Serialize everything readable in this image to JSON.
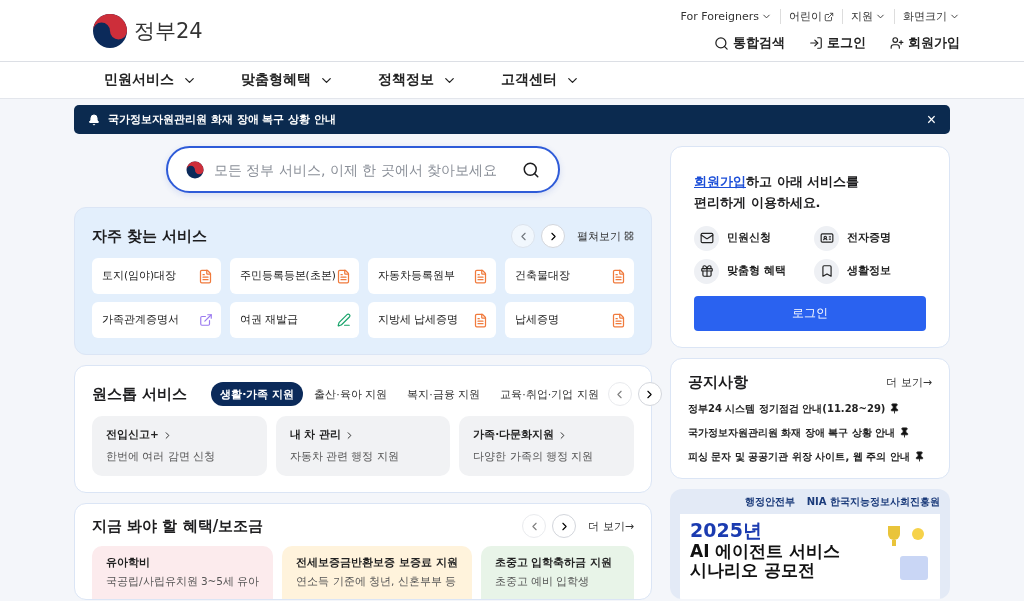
{
  "header": {
    "logo_text": "정부24",
    "utility_links": [
      {
        "label": "For Foreigners",
        "kind": "dropdown"
      },
      {
        "label": "어린이",
        "kind": "external"
      },
      {
        "label": "지원",
        "kind": "dropdown"
      },
      {
        "label": "화면크기",
        "kind": "dropdown"
      }
    ],
    "actions": [
      {
        "label": "통합검색",
        "kind": "search"
      },
      {
        "label": "로그인",
        "kind": "login"
      },
      {
        "label": "회원가입",
        "kind": "join"
      }
    ]
  },
  "nav": [
    "민원서비스",
    "맞춤형혜택",
    "정책정보",
    "고객센터"
  ],
  "notice_bar": {
    "text": "국가정보자원관리원 화재 장애 복구 상황 안내",
    "close": "×"
  },
  "search": {
    "placeholder": "모든 정부 서비스, 이제 한 곳에서 찾아보세요"
  },
  "frequent": {
    "title": "자주 찾는 서비스",
    "expand": "펼쳐보기",
    "items": [
      {
        "label": "토지(임야)대장",
        "kind": "document"
      },
      {
        "label": "주민등록등본(초본)",
        "kind": "document"
      },
      {
        "label": "자동차등록원부",
        "kind": "document"
      },
      {
        "label": "건축물대장",
        "kind": "document"
      },
      {
        "label": "가족관계증명서",
        "kind": "external"
      },
      {
        "label": "여권 재발급",
        "kind": "edit"
      },
      {
        "label": "지방세 납세증명",
        "kind": "document"
      },
      {
        "label": "납세증명",
        "kind": "document"
      }
    ]
  },
  "onestop": {
    "title": "원스톱 서비스",
    "tabs": [
      {
        "label": "생활·가족 지원",
        "selected": true
      },
      {
        "label": "출산·육아 지원",
        "selected": false
      },
      {
        "label": "복지·금융 지원",
        "selected": false
      },
      {
        "label": "교육·취업·기업 지원",
        "selected": false
      }
    ],
    "cards": [
      {
        "title": "전입신고+",
        "desc": "한번에 여러 감면 신청"
      },
      {
        "title": "내 차 관리",
        "desc": "자동차 관련 행정 지원"
      },
      {
        "title": "가족·다문화지원",
        "desc": "다양한 가족의 행정 지원"
      }
    ]
  },
  "benefits": {
    "title": "지금 봐야 할 혜택/보조금",
    "more": "더 보기→",
    "cards": [
      {
        "title": "유아학비",
        "desc": "국공립/사립유치원 3~5세 유아",
        "color": "#fcebed"
      },
      {
        "title": "전세보증금반환보증 보증료 지원",
        "desc": "연소득 기준에 청년, 신혼부부 등",
        "color": "#fff3dc"
      },
      {
        "title": "초중고 입학축하금 지원",
        "desc": "초중고 예비 입학생",
        "color": "#e8f4e8"
      }
    ]
  },
  "login_card": {
    "link": "회원가입",
    "message": "하고 아래 서비스를",
    "message2": "편리하게 이용하세요.",
    "features": [
      {
        "label": "민원신청",
        "kind": "mail"
      },
      {
        "label": "전자증명",
        "kind": "id"
      },
      {
        "label": "맞춤형 혜택",
        "kind": "gift"
      },
      {
        "label": "생활정보",
        "kind": "bookmark"
      }
    ],
    "button": "로그인"
  },
  "notices": {
    "title": "공지사항",
    "more": "더 보기→",
    "items": [
      {
        "text": "정부24 시스템 정기점검 안내(11.28~29)",
        "pinned": true
      },
      {
        "text": "국가정보자원관리원 화재 장애 복구 상황 안내",
        "pinned": true
      },
      {
        "text": "피싱 문자 및 공공기관 위장 사이트, 웹 주의 안내",
        "pinned": true
      }
    ]
  },
  "promo": {
    "sponsors": [
      "행정안전부",
      "NIA 한국지능정보사회진흥원"
    ],
    "year": "2025년",
    "line1": "AI 에이전트 서비스",
    "line2": "시나리오 공모전"
  }
}
